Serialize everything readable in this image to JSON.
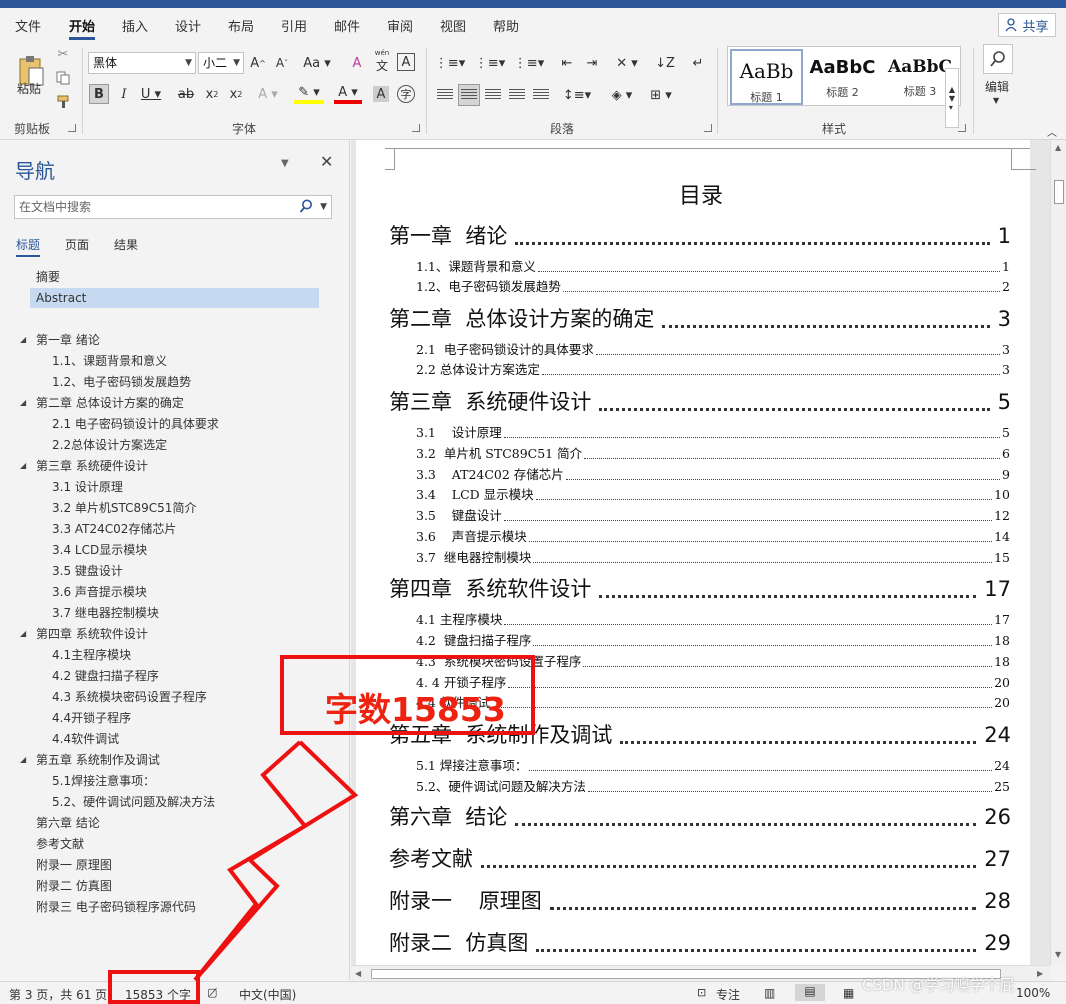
{
  "menu": {
    "tabs": [
      "文件",
      "开始",
      "插入",
      "设计",
      "布局",
      "引用",
      "邮件",
      "审阅",
      "视图",
      "帮助"
    ],
    "active_tab": "开始",
    "share_label": "共享"
  },
  "ribbon": {
    "paste_label": "粘贴",
    "clipboard_label": "剪贴板",
    "font_name": "黑体",
    "font_size": "小二",
    "font_label": "字体",
    "paragraph_label": "段落",
    "styles_label": "样式",
    "edit_label": "编辑",
    "style_samples": [
      {
        "sample": "AaBb",
        "name": "标题 1"
      },
      {
        "sample": "AaBbC",
        "name": "标题 2"
      },
      {
        "sample": "AaBbC",
        "name": "标题 3"
      }
    ],
    "wen_label": "wén"
  },
  "nav": {
    "title": "导航",
    "search_placeholder": "在文档中搜索",
    "tabs": [
      "标题",
      "页面",
      "结果"
    ],
    "items": [
      {
        "label": "摘要",
        "level": 1,
        "tri": false
      },
      {
        "label": "Abstract",
        "level": 1,
        "tri": false,
        "selected": true
      },
      {
        "label": "第一章 绪论",
        "level": 1,
        "tri": true
      },
      {
        "label": "1.1、课题背景和意义",
        "level": 2,
        "tri": false
      },
      {
        "label": "1.2、电子密码锁发展趋势",
        "level": 2,
        "tri": false
      },
      {
        "label": "第二章 总体设计方案的确定",
        "level": 1,
        "tri": true
      },
      {
        "label": "2.1 电子密码锁设计的具体要求",
        "level": 2,
        "tri": false
      },
      {
        "label": "2.2总体设计方案选定",
        "level": 2,
        "tri": false
      },
      {
        "label": "第三章 系统硬件设计",
        "level": 1,
        "tri": true
      },
      {
        "label": "3.1  设计原理",
        "level": 2,
        "tri": false
      },
      {
        "label": "3.2 单片机STC89C51简介",
        "level": 2,
        "tri": false
      },
      {
        "label": "3.3   AT24C02存储芯片",
        "level": 2,
        "tri": false
      },
      {
        "label": "3.4  LCD显示模块",
        "level": 2,
        "tri": false
      },
      {
        "label": "3.5   键盘设计",
        "level": 2,
        "tri": false
      },
      {
        "label": "3.6   声音提示模块",
        "level": 2,
        "tri": false
      },
      {
        "label": "3.7 继电器控制模块",
        "level": 2,
        "tri": false
      },
      {
        "label": "第四章 系统软件设计",
        "level": 1,
        "tri": true
      },
      {
        "label": "4.1主程序模块",
        "level": 2,
        "tri": false
      },
      {
        "label": "4.2  键盘扫描子程序",
        "level": 2,
        "tri": false
      },
      {
        "label": "4.3 系统模块密码设置子程序",
        "level": 2,
        "tri": false
      },
      {
        "label": "4.4开锁子程序",
        "level": 2,
        "tri": false
      },
      {
        "label": "4.4软件调试",
        "level": 2,
        "tri": false
      },
      {
        "label": "第五章 系统制作及调试",
        "level": 1,
        "tri": true
      },
      {
        "label": "5.1焊接注意事项：",
        "level": 2,
        "tri": false
      },
      {
        "label": "5.2、硬件调试问题及解决方法",
        "level": 2,
        "tri": false
      },
      {
        "label": "第六章 结论",
        "level": 1,
        "tri": false
      },
      {
        "label": "参考文献",
        "level": 1,
        "tri": false
      },
      {
        "label": "附录一  原理图",
        "level": 1,
        "tri": false
      },
      {
        "label": "附录二 仿真图",
        "level": 1,
        "tri": false
      },
      {
        "label": "附录三 电子密码锁程序源代码",
        "level": 1,
        "tri": false
      }
    ]
  },
  "document": {
    "toc_heading": "目录",
    "toc": [
      {
        "label": "第一章  绪论",
        "page": "1",
        "level": 1
      },
      {
        "label": "1.1、课题背景和意义",
        "page": "1",
        "level": 2
      },
      {
        "label": "1.2、电子密码锁发展趋势",
        "page": "2",
        "level": 2
      },
      {
        "label": "第二章  总体设计方案的确定",
        "page": "3",
        "level": 1
      },
      {
        "label": "2.1  电子密码锁设计的具体要求",
        "page": "3",
        "level": 2
      },
      {
        "label": "2.2 总体设计方案选定",
        "page": "3",
        "level": 2
      },
      {
        "label": "第三章  系统硬件设计",
        "page": "5",
        "level": 1
      },
      {
        "label": "3.1    设计原理",
        "page": "5",
        "level": 2
      },
      {
        "label": "3.2  单片机 STC89C51 简介",
        "page": "6",
        "level": 2
      },
      {
        "label": "3.3    AT24C02 存储芯片",
        "page": "9",
        "level": 2
      },
      {
        "label": "3.4    LCD 显示模块",
        "page": "10",
        "level": 2
      },
      {
        "label": "3.5    键盘设计",
        "page": "12",
        "level": 2
      },
      {
        "label": "3.6    声音提示模块",
        "page": "14",
        "level": 2
      },
      {
        "label": "3.7  继电器控制模块",
        "page": "15",
        "level": 2
      },
      {
        "label": "第四章  系统软件设计",
        "page": "17",
        "level": 1
      },
      {
        "label": "4.1 主程序模块",
        "page": "17",
        "level": 2
      },
      {
        "label": "4.2  键盘扫描子程序",
        "page": "18",
        "level": 2
      },
      {
        "label": "4.3  系统模块密码设置子程序",
        "page": "18",
        "level": 2
      },
      {
        "label": "4. 4 开锁子程序",
        "page": "20",
        "level": 2
      },
      {
        "label": "4.4 软件调试",
        "page": "20",
        "level": 2
      },
      {
        "label": "第五章  系统制作及调试",
        "page": "24",
        "level": 1
      },
      {
        "label": "5.1 焊接注意事项：",
        "page": "24",
        "level": 2
      },
      {
        "label": "5.2、硬件调试问题及解决方法",
        "page": "25",
        "level": 2
      },
      {
        "label": "第六章  结论",
        "page": "26",
        "level": 1
      },
      {
        "label": "参考文献",
        "page": "27",
        "level": 1
      },
      {
        "label": "附录一    原理图",
        "page": "28",
        "level": 1
      },
      {
        "label": "附录二  仿真图",
        "page": "29",
        "level": 1
      }
    ]
  },
  "status": {
    "page_info": "第 3 页，共 61 页",
    "word_count": "15853 个字",
    "language": "中文(中国)",
    "focus_label": "专注",
    "zoom": "100%"
  },
  "annotation": {
    "text": "字数15853",
    "color": "#e11111"
  },
  "watermark": "CSDN @学习噢学个屁"
}
